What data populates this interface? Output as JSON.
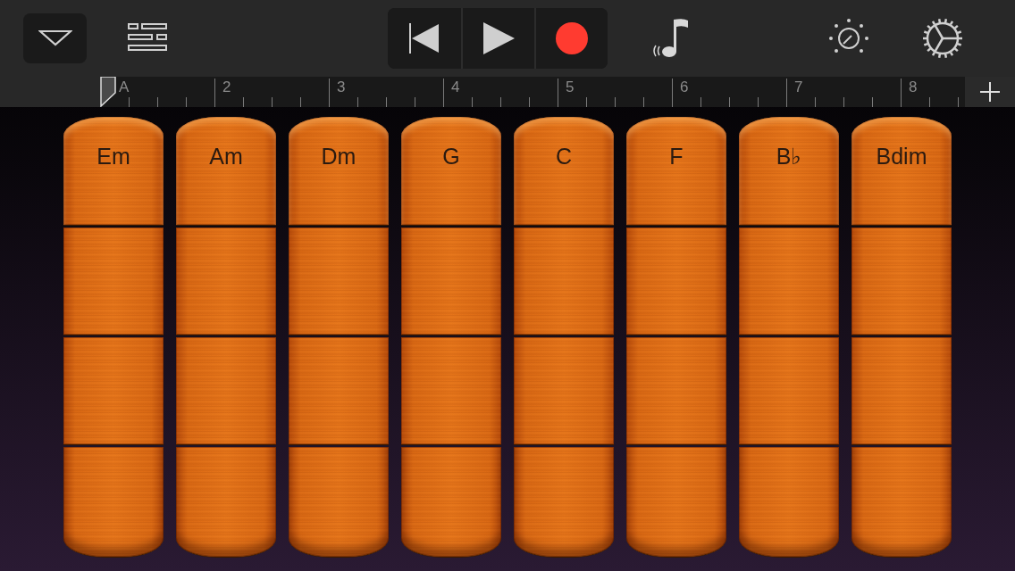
{
  "ruler": {
    "markers": [
      "A",
      "2",
      "3",
      "4",
      "5",
      "6",
      "7",
      "8"
    ]
  },
  "chords": [
    {
      "label": "Em"
    },
    {
      "label": "Am"
    },
    {
      "label": "Dm"
    },
    {
      "label": "G"
    },
    {
      "label": "C"
    },
    {
      "label": "F"
    },
    {
      "label": "B♭"
    },
    {
      "label": "Bdim"
    }
  ]
}
